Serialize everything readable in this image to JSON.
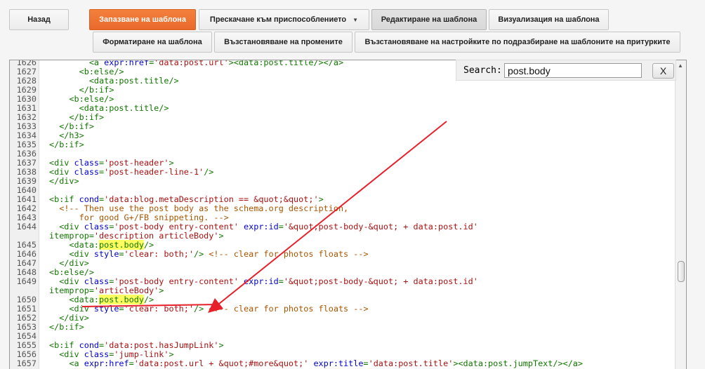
{
  "toolbar": {
    "back": "Назад",
    "save_template": "Запазване на шаблона",
    "jump_to_widget": "Прескачане към приспособлението",
    "edit_template": "Редактиране на шаблона",
    "preview_template": "Визуализация на шаблона",
    "format_template": "Форматиране на шаблона",
    "revert_changes": "Възстановяване на промените",
    "restore_defaults": "Възстановяване на настройките по подразбиране на шаблоните на притурките"
  },
  "search": {
    "label": "Search:",
    "value": "post.body",
    "close_label": "X"
  },
  "editor": {
    "lines": [
      {
        "n": "1626",
        "t": "        <a expr:href='data:post.url'><data:post.title/></a>"
      },
      {
        "n": "1627",
        "t": "      <b:else/>"
      },
      {
        "n": "1628",
        "t": "        <data:post.title/>"
      },
      {
        "n": "1629",
        "t": "      </b:if>"
      },
      {
        "n": "1630",
        "t": "    <b:else/>"
      },
      {
        "n": "1631",
        "t": "      <data:post.title/>"
      },
      {
        "n": "1632",
        "t": "    </b:if>"
      },
      {
        "n": "1633",
        "t": "  </b:if>"
      },
      {
        "n": "1634",
        "t": "  </h3>"
      },
      {
        "n": "1635",
        "t": "</b:if>"
      },
      {
        "n": "1636",
        "t": ""
      },
      {
        "n": "1637",
        "t": "<div class='post-header'>"
      },
      {
        "n": "1638",
        "t": "<div class='post-header-line-1'/>"
      },
      {
        "n": "1639",
        "t": "</div>"
      },
      {
        "n": "1640",
        "t": ""
      },
      {
        "n": "1641",
        "t": "<b:if cond='data:blog.metaDescription == &quot;&quot;'>"
      },
      {
        "n": "1642",
        "t": "  <!-- Then use the post body as the schema.org description,"
      },
      {
        "n": "1643",
        "t": "      for good G+/FB snippeting. -->"
      },
      {
        "n": "1644",
        "t": "  <div class='post-body entry-content' expr:id='&quot;post-body-&quot; + data:post.id'"
      },
      {
        "n": "",
        "t": "itemprop='description articleBody'>",
        "wrap": true
      },
      {
        "n": "1645",
        "t": "    <data:post.body/>"
      },
      {
        "n": "1646",
        "t": "    <div style='clear: both;'/> <!-- clear for photos floats -->"
      },
      {
        "n": "1647",
        "t": "  </div>"
      },
      {
        "n": "1648",
        "t": "<b:else/>"
      },
      {
        "n": "1649",
        "t": "  <div class='post-body entry-content' expr:id='&quot;post-body-&quot; + data:post.id'"
      },
      {
        "n": "",
        "t": "itemprop='articleBody'>",
        "wrap": true
      },
      {
        "n": "1650",
        "t": "    <data:post.body/>"
      },
      {
        "n": "1651",
        "t": "    <div style='clear: both;'/> <!-- clear for photos floats -->"
      },
      {
        "n": "1652",
        "t": "  </div>"
      },
      {
        "n": "1653",
        "t": "</b:if>"
      },
      {
        "n": "1654",
        "t": ""
      },
      {
        "n": "1655",
        "t": "<b:if cond='data:post.hasJumpLink'>"
      },
      {
        "n": "1656",
        "t": "  <div class='jump-link'>"
      },
      {
        "n": "1657",
        "t": "    <a expr:href='data:post.url + &quot;#more&quot;' expr:title='data:post.title'><data:post.jumpText/></a>"
      }
    ],
    "highlight_term": "post.body",
    "annotation_color": "#e8202a"
  }
}
